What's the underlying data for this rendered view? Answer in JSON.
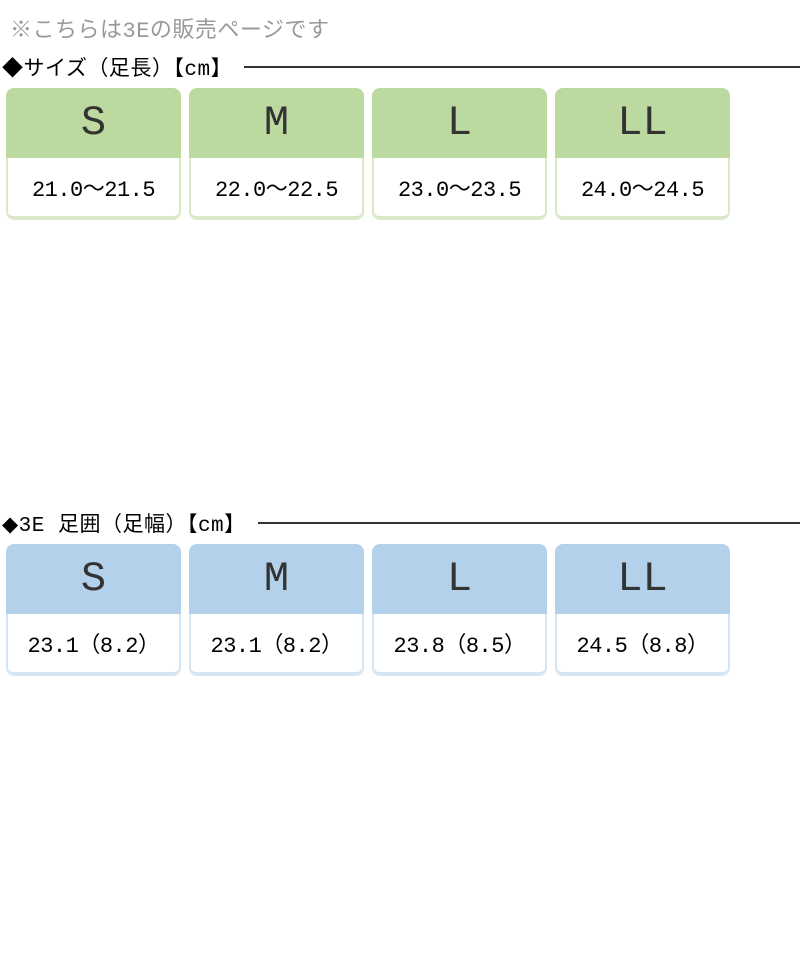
{
  "notice": "※こちらは3Eの販売ページです",
  "sections": [
    {
      "title": "◆サイズ（足長）【cm】",
      "color": "green",
      "items": [
        {
          "label": "S",
          "value": "21.0～21.5"
        },
        {
          "label": "M",
          "value": "22.0～22.5"
        },
        {
          "label": "L",
          "value": "23.0～23.5"
        },
        {
          "label": "LL",
          "value": "24.0～24.5"
        }
      ]
    },
    {
      "title": "◆3E 足囲（足幅）【cm】",
      "color": "blue",
      "items": [
        {
          "label": "S",
          "value": "23.1（8.2）"
        },
        {
          "label": "M",
          "value": "23.1（8.2）"
        },
        {
          "label": "L",
          "value": "23.8（8.5）"
        },
        {
          "label": "LL",
          "value": "24.5（8.8）"
        }
      ]
    }
  ]
}
